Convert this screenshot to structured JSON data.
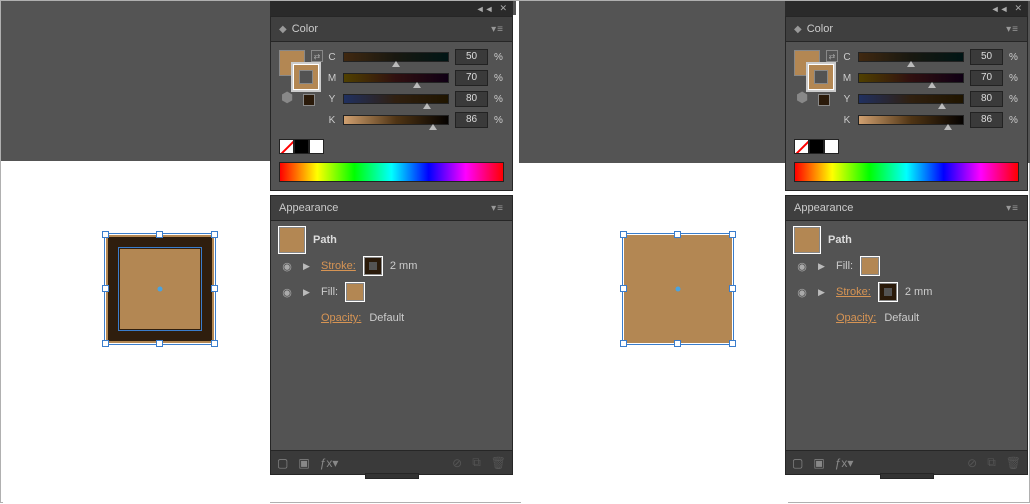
{
  "colors": {
    "fill": "#b38753",
    "strokeDark": "#2f1e0e",
    "accent": "#d69454"
  },
  "color_panel": {
    "title": "Color",
    "sliders": [
      {
        "label": "C",
        "value": "50",
        "pct": "%",
        "pos": 50
      },
      {
        "label": "M",
        "value": "70",
        "pct": "%",
        "pos": 70
      },
      {
        "label": "Y",
        "value": "80",
        "pct": "%",
        "pos": 80
      },
      {
        "label": "K",
        "value": "86",
        "pct": "%",
        "pos": 86
      }
    ],
    "palette": [
      "none",
      "#000000",
      "#ffffff"
    ]
  },
  "appearance_panel": {
    "title": "Appearance",
    "path_label": "Path",
    "stroke_label": "Stroke:",
    "fill_label": "Fill:",
    "stroke_value": "2 mm",
    "opacity_label": "Opacity:",
    "opacity_value": "Default"
  },
  "views": [
    {
      "order": "stroke_first"
    },
    {
      "order": "fill_first"
    }
  ]
}
